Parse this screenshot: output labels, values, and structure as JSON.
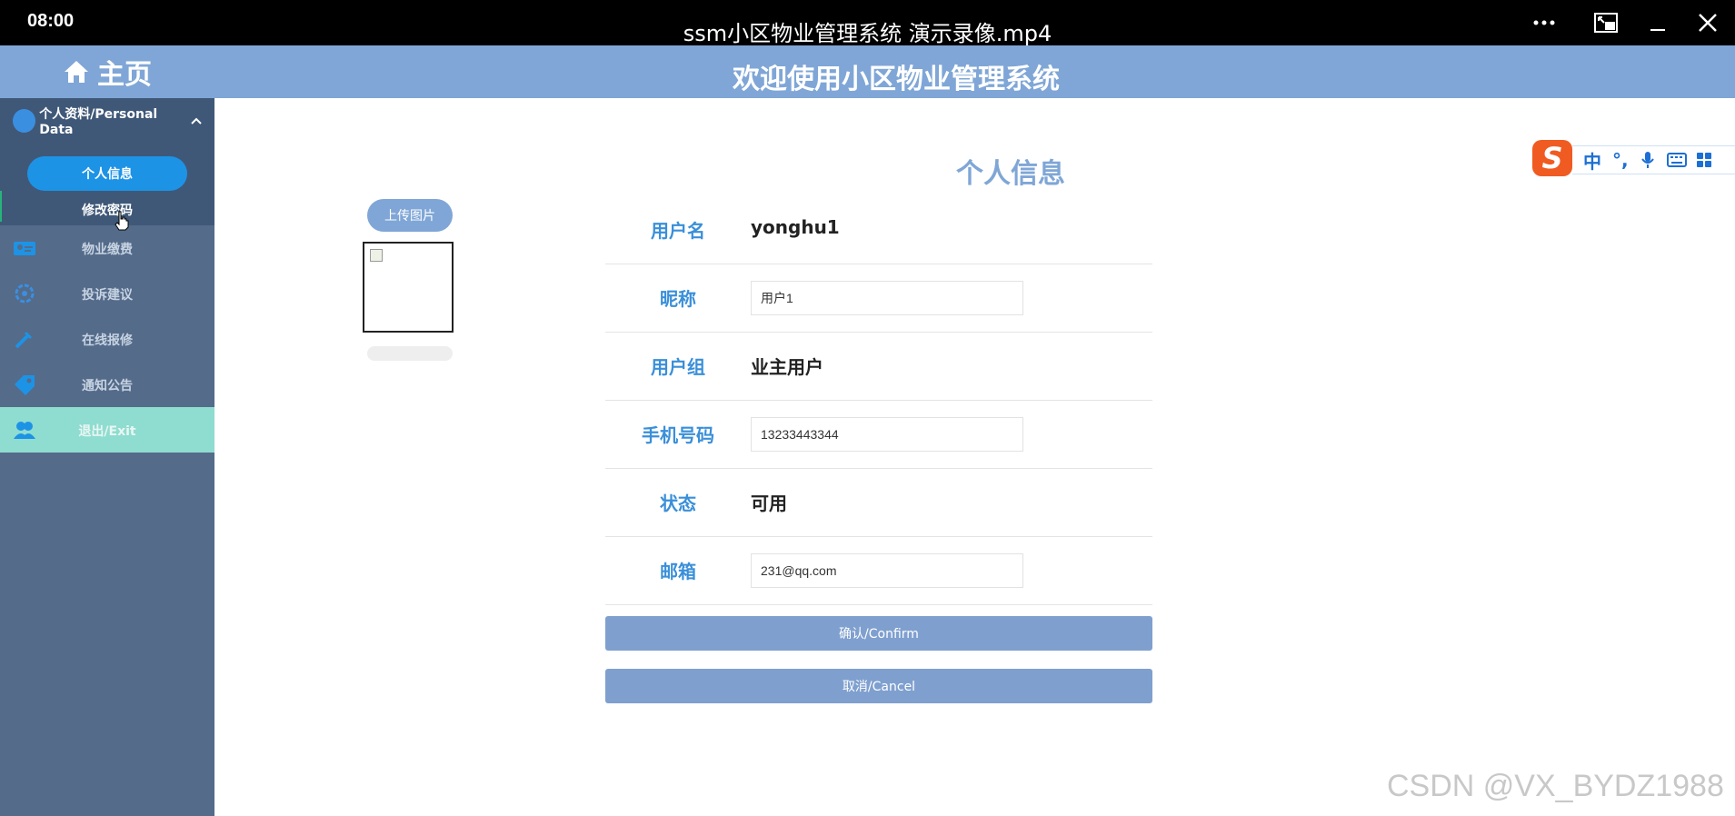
{
  "player": {
    "time": "08:00",
    "title": "ssm小区物业管理系统 演示录像.mp4"
  },
  "header": {
    "home_label": "主页",
    "welcome": "欢迎使用小区物业管理系统"
  },
  "sidebar": {
    "group_label": "个人资料/Personal Data",
    "sub_items": [
      {
        "label": "个人信息",
        "active": true
      },
      {
        "label": "修改密码",
        "active": false
      }
    ],
    "items": [
      {
        "label": "物业缴费",
        "icon": "id-card-icon"
      },
      {
        "label": "投诉建议",
        "icon": "settings-icon"
      },
      {
        "label": "在线报修",
        "icon": "wrench-icon"
      },
      {
        "label": "通知公告",
        "icon": "tag-icon"
      },
      {
        "label": "退出/Exit",
        "icon": "users-icon"
      }
    ]
  },
  "main": {
    "title": "个人信息",
    "upload_label": "上传图片",
    "fields": [
      {
        "label": "用户名",
        "value": "yonghu1",
        "editable": false
      },
      {
        "label": "昵称",
        "value": "用户1",
        "editable": true
      },
      {
        "label": "用户组",
        "value": "业主用户",
        "editable": false
      },
      {
        "label": "手机号码",
        "value": "13233443344",
        "editable": true
      },
      {
        "label": "状态",
        "value": "可用",
        "editable": false
      },
      {
        "label": "邮箱",
        "value": "231@qq.com",
        "editable": true
      }
    ],
    "confirm_label": "确认/Confirm",
    "cancel_label": "取消/Cancel"
  },
  "ime": {
    "logo": "S",
    "mode": "中",
    "punct": "°,"
  },
  "watermark": "CSDN @VX_BYDZ1988",
  "colors": {
    "accent": "#7fa6d6",
    "sidebar": "#546b8a",
    "active_pill": "#1d93e6",
    "exit_bg": "#8fdcd0",
    "label_blue": "#3a8fd9"
  }
}
